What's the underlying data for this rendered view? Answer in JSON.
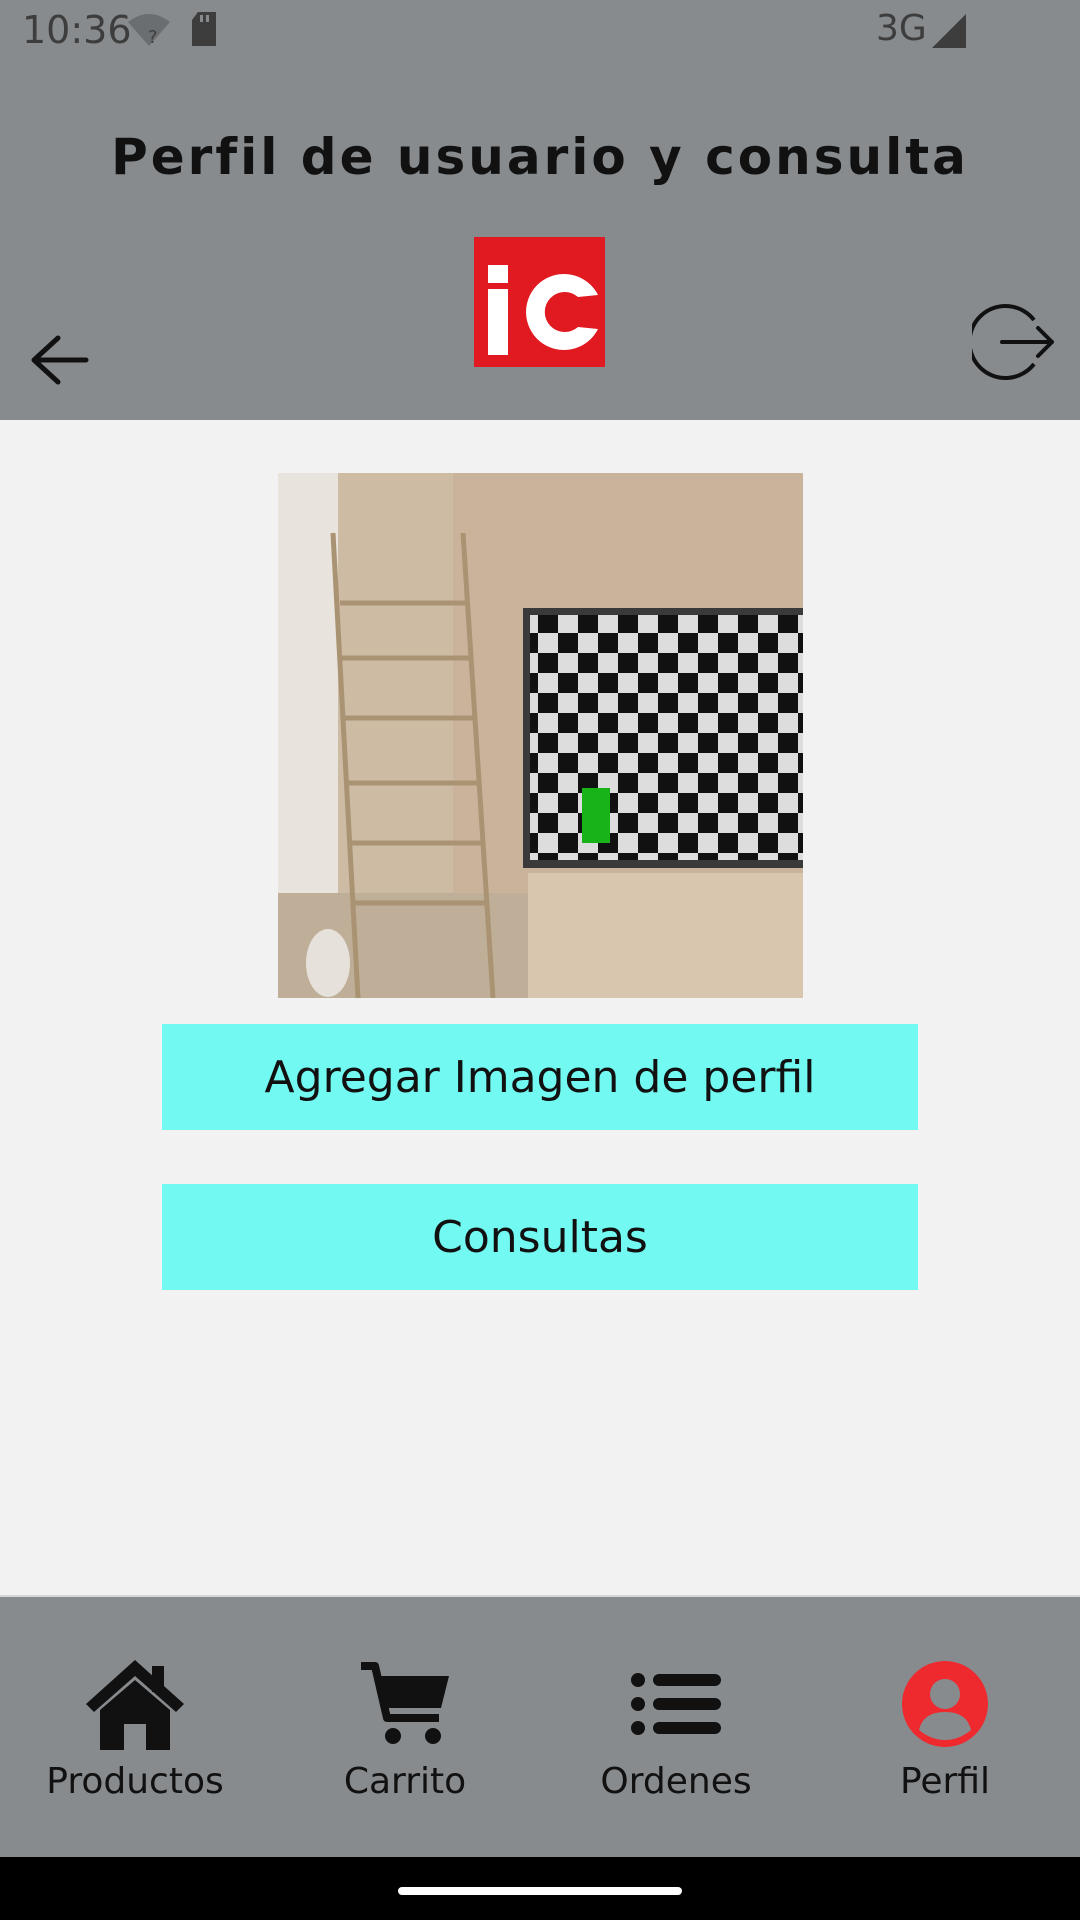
{
  "status_bar": {
    "time": "10:36",
    "network": "3G",
    "icons": [
      "wifi-icon",
      "sd-card-icon",
      "signal-icon"
    ]
  },
  "header": {
    "title": "Perfil de usuario y consulta",
    "logo_text": "iC",
    "back_icon": "arrow-left-icon",
    "logout_icon": "logout-icon",
    "logo_color": "#e11a22",
    "background": "#878b8e"
  },
  "main": {
    "profile_image": "room-photo",
    "add_image_button": "Agregar Imagen de perfil",
    "consultas_button": "Consultas",
    "button_color": "#72f9f1"
  },
  "bottom_nav": {
    "items": [
      {
        "label": "Productos",
        "icon": "home-icon",
        "active": false
      },
      {
        "label": "Carrito",
        "icon": "cart-icon",
        "active": false
      },
      {
        "label": "Ordenes",
        "icon": "list-icon",
        "active": false
      },
      {
        "label": "Perfil",
        "icon": "user-icon",
        "active": true
      }
    ],
    "active_color": "#ee2a2f"
  }
}
